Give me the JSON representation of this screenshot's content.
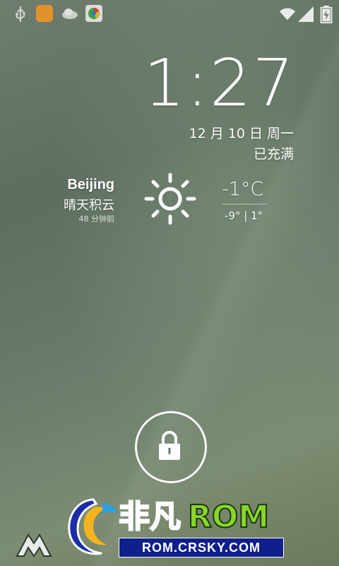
{
  "status_bar": {
    "icons": [
      "usb-icon",
      "qq-icon",
      "cloud-icon",
      "browser-icon",
      "wifi-icon",
      "signal-icon",
      "battery-icon"
    ]
  },
  "lockscreen": {
    "time": "1:27",
    "date": "12 月 10 日 周一",
    "charge_status": "已充满"
  },
  "weather": {
    "city": "Beijing",
    "condition": "晴天积云",
    "updated": "48 分钟前",
    "temperature": "-1°C",
    "range": "-9° | 1°",
    "icon": "sun-icon"
  },
  "unlock": {
    "icon": "lock-icon"
  },
  "watermark": {
    "cn": "非凡",
    "rom": "ROM",
    "url": "ROM.CRSKY.COM"
  },
  "colors": {
    "wallpaper": "#6b7a6b",
    "text": "#ffffff",
    "watermark_blue": "#1b2da8",
    "watermark_green": "#8bd42a"
  }
}
